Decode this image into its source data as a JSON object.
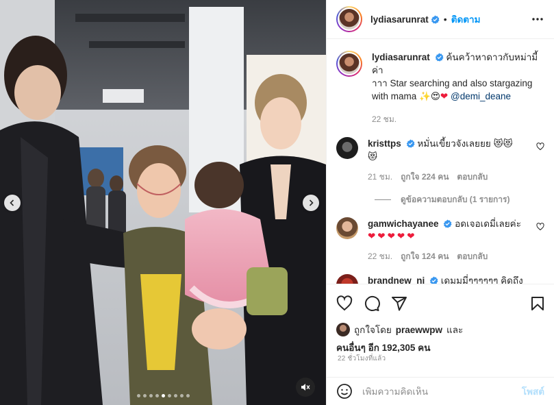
{
  "post": {
    "username": "lydiasarunrat",
    "follow_label": "ติดตาม",
    "caption_line1": "ค้นคว้าหาดาวกับหม่ามี้ค่า",
    "caption_line2": "าาา Star searching and also stargazing",
    "caption_line3": "with mama",
    "caption_emoji": "✨😍",
    "caption_heart": "❤",
    "caption_mention": "@demi_deane",
    "caption_time": "22 ชม."
  },
  "comments": [
    {
      "username": "kristtps",
      "text_line1": "หมั่นเขี้ยวจังเลยยย",
      "text_emoji1": "😻😻",
      "text_emoji2": "😻",
      "time": "21 ชม.",
      "likes": "ถูกใจ 224 คน",
      "reply_label": "ตอบกลับ",
      "view_replies": "ดูข้อความตอบกลับ (1 รายการ)"
    },
    {
      "username": "gamwichayanee",
      "text_line1": "อดเจอเดมี่เลยค่ะ",
      "text_emoji1": "❤❤❤❤❤",
      "time": "22 ชม.",
      "likes": "ถูกใจ 124 คน",
      "reply_label": "ตอบกลับ"
    },
    {
      "username": "brandnew_nj",
      "text_line1": "เดมมมี่ๆๆๆๆๆๆ คิดถึงจัง"
    }
  ],
  "likes": {
    "line1_prefix": "ถูกใจโดย",
    "line1_user": "praewwpw",
    "line1_suffix": "และ",
    "line2": "คนอื่นๆ อีก 192,305 คน"
  },
  "time_ago": "22 ชั่วโมงที่แล้ว",
  "add_comment": {
    "placeholder": "เพิ่มความคิดเห็น",
    "post_label": "โพสต์"
  },
  "carousel": {
    "dot_count": 9,
    "active_index": 4
  },
  "icons": {
    "verified": "verified-badge-icon",
    "more": "more-options-icon",
    "heart": "heart-icon",
    "comment": "comment-icon",
    "share": "share-icon",
    "save": "bookmark-icon",
    "emoji": "emoji-icon",
    "mute": "muted-speaker-icon",
    "prev": "chevron-left-icon",
    "next": "chevron-right-icon"
  },
  "colors": {
    "accent": "#0095f6",
    "verified": "#3897f0",
    "post_disabled": "#b2dffc",
    "text_secondary": "#8e8e8e",
    "border": "#efefef"
  }
}
